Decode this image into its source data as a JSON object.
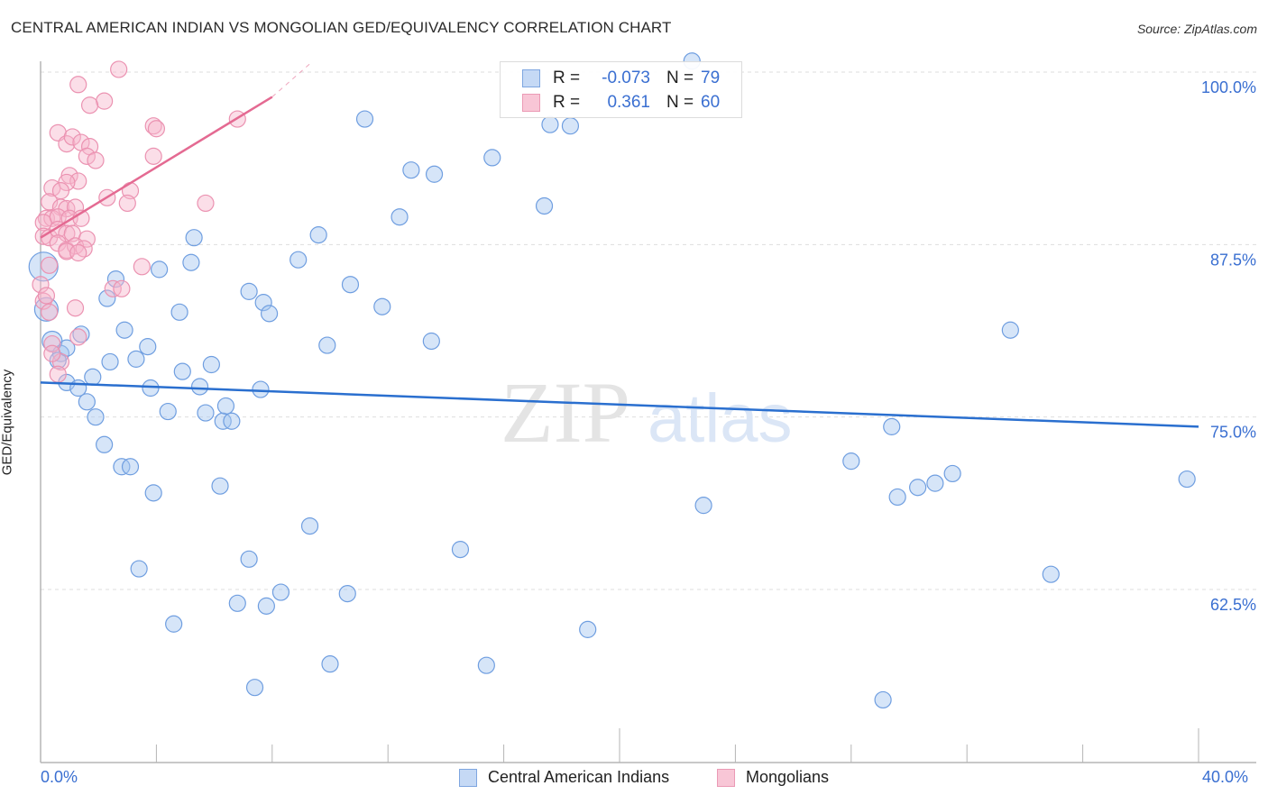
{
  "title": "CENTRAL AMERICAN INDIAN VS MONGOLIAN GED/EQUIVALENCY CORRELATION CHART",
  "source": "Source: ZipAtlas.com",
  "watermark": {
    "part1": "ZIP",
    "part2": "atlas"
  },
  "colors": {
    "blue": "#3a7bd5",
    "blue_fill": "#c5d9f5",
    "blue_line": "#2a6fcf",
    "pink": "#e8739a",
    "pink_fill": "#f8c6d6",
    "pink_line": "#e46a92",
    "axis_text": "#3a6fd1"
  },
  "legend": {
    "rows": [
      {
        "series": "Central American Indians",
        "r_label": "R =",
        "r_value": "-0.073",
        "n_label": "N =",
        "n_value": "79"
      },
      {
        "series": "Mongolians",
        "r_label": "R =",
        "r_value": "0.361",
        "n_label": "N =",
        "n_value": "60"
      }
    ]
  },
  "bottom_legend": [
    "Central American Indians",
    "Mongolians"
  ],
  "chart_data": {
    "type": "scatter",
    "title": "CENTRAL AMERICAN INDIAN VS MONGOLIAN GED/EQUIVALENCY CORRELATION CHART",
    "xlabel": "",
    "ylabel": "GED/Equivalency",
    "xlim": [
      0,
      40
    ],
    "ylim": [
      50,
      101.2
    ],
    "x_tick_labels": [
      "0.0%",
      "40.0%"
    ],
    "x_ticks": [
      0,
      4,
      8,
      12,
      16,
      20,
      24,
      28,
      32,
      36,
      40
    ],
    "y_ticks": [
      100.0,
      87.5,
      75.0,
      62.5
    ],
    "y_tick_labels": [
      "100.0%",
      "87.5%",
      "75.0%",
      "62.5%"
    ],
    "grid": "horizontal-dashed",
    "legend_position": "top-center",
    "series": [
      {
        "name": "Central American Indians",
        "r": -0.073,
        "n": 79,
        "trend": {
          "x": [
            0,
            40
          ],
          "y": [
            77.5,
            74.3
          ]
        },
        "points": [
          [
            0.1,
            85.9
          ],
          [
            0.2,
            82.8
          ],
          [
            0.4,
            80.5
          ],
          [
            0.7,
            79.6
          ],
          [
            0.6,
            79.1
          ],
          [
            0.9,
            80.0
          ],
          [
            1.4,
            81.0
          ],
          [
            0.9,
            77.5
          ],
          [
            1.3,
            77.1
          ],
          [
            1.8,
            77.9
          ],
          [
            1.6,
            76.1
          ],
          [
            1.9,
            75.0
          ],
          [
            2.2,
            73.0
          ],
          [
            2.4,
            79.0
          ],
          [
            2.6,
            85.0
          ],
          [
            2.3,
            83.6
          ],
          [
            2.9,
            81.3
          ],
          [
            3.3,
            79.2
          ],
          [
            3.7,
            80.1
          ],
          [
            3.8,
            77.1
          ],
          [
            2.8,
            71.4
          ],
          [
            3.1,
            71.4
          ],
          [
            3.9,
            69.5
          ],
          [
            3.4,
            64.0
          ],
          [
            4.1,
            85.7
          ],
          [
            4.4,
            75.4
          ],
          [
            4.8,
            82.6
          ],
          [
            4.9,
            78.3
          ],
          [
            5.2,
            86.2
          ],
          [
            5.3,
            88.0
          ],
          [
            5.5,
            77.2
          ],
          [
            5.7,
            75.3
          ],
          [
            5.9,
            78.8
          ],
          [
            6.2,
            70.0
          ],
          [
            6.3,
            74.7
          ],
          [
            6.4,
            75.8
          ],
          [
            6.6,
            74.7
          ],
          [
            7.2,
            84.1
          ],
          [
            7.7,
            83.3
          ],
          [
            7.9,
            82.5
          ],
          [
            7.6,
            77.0
          ],
          [
            4.6,
            60.0
          ],
          [
            6.8,
            61.5
          ],
          [
            7.2,
            64.7
          ],
          [
            7.4,
            55.4
          ],
          [
            7.8,
            61.3
          ],
          [
            8.3,
            62.3
          ],
          [
            8.9,
            86.4
          ],
          [
            9.3,
            67.1
          ],
          [
            9.6,
            88.2
          ],
          [
            9.9,
            80.2
          ],
          [
            10.0,
            57.1
          ],
          [
            10.6,
            62.2
          ],
          [
            10.7,
            84.6
          ],
          [
            11.8,
            83.0
          ],
          [
            11.2,
            96.6
          ],
          [
            12.4,
            89.5
          ],
          [
            12.8,
            92.9
          ],
          [
            13.6,
            92.6
          ],
          [
            13.5,
            80.5
          ],
          [
            14.5,
            65.4
          ],
          [
            15.4,
            57.0
          ],
          [
            15.6,
            93.8
          ],
          [
            17.4,
            90.3
          ],
          [
            17.6,
            96.2
          ],
          [
            18.3,
            96.1
          ],
          [
            18.9,
            59.6
          ],
          [
            22.9,
            68.6
          ],
          [
            28.0,
            71.8
          ],
          [
            29.4,
            74.3
          ],
          [
            29.1,
            54.5
          ],
          [
            29.6,
            69.2
          ],
          [
            30.3,
            69.9
          ],
          [
            30.9,
            70.2
          ],
          [
            31.5,
            70.9
          ],
          [
            33.5,
            81.3
          ],
          [
            34.9,
            63.6
          ],
          [
            39.6,
            70.5
          ],
          [
            22.5,
            100.8
          ]
        ]
      },
      {
        "name": "Mongolians",
        "r": 0.361,
        "n": 60,
        "trend": {
          "x": [
            0,
            8.0
          ],
          "y": [
            88.0,
            98.2
          ]
        },
        "trend_dashed_extension": {
          "x": [
            8.0,
            9.3
          ],
          "y": [
            98.2,
            100.6
          ]
        },
        "points": [
          [
            2.7,
            100.2
          ],
          [
            1.3,
            99.1
          ],
          [
            2.2,
            97.9
          ],
          [
            1.7,
            97.6
          ],
          [
            3.9,
            96.1
          ],
          [
            4.0,
            95.9
          ],
          [
            6.8,
            96.6
          ],
          [
            0.6,
            95.6
          ],
          [
            0.9,
            94.8
          ],
          [
            1.1,
            95.3
          ],
          [
            1.4,
            94.9
          ],
          [
            1.7,
            94.6
          ],
          [
            1.6,
            93.9
          ],
          [
            1.9,
            93.6
          ],
          [
            3.9,
            93.9
          ],
          [
            1.0,
            92.5
          ],
          [
            1.3,
            92.1
          ],
          [
            0.9,
            92.0
          ],
          [
            0.4,
            91.6
          ],
          [
            0.7,
            91.4
          ],
          [
            2.3,
            90.9
          ],
          [
            3.1,
            91.4
          ],
          [
            3.0,
            90.5
          ],
          [
            5.7,
            90.5
          ],
          [
            0.3,
            90.6
          ],
          [
            0.7,
            90.2
          ],
          [
            0.9,
            90.1
          ],
          [
            1.2,
            90.2
          ],
          [
            0.2,
            89.4
          ],
          [
            0.4,
            89.4
          ],
          [
            0.1,
            89.1
          ],
          [
            0.6,
            89.5
          ],
          [
            1.0,
            89.4
          ],
          [
            1.4,
            89.4
          ],
          [
            0.1,
            88.1
          ],
          [
            0.3,
            88.0
          ],
          [
            0.6,
            88.6
          ],
          [
            0.9,
            88.3
          ],
          [
            1.1,
            88.3
          ],
          [
            1.6,
            87.9
          ],
          [
            0.6,
            87.6
          ],
          [
            0.9,
            87.1
          ],
          [
            1.2,
            87.4
          ],
          [
            1.5,
            87.2
          ],
          [
            0.9,
            87.0
          ],
          [
            1.3,
            86.9
          ],
          [
            3.5,
            85.9
          ],
          [
            0.3,
            86.0
          ],
          [
            0.0,
            84.6
          ],
          [
            0.1,
            83.4
          ],
          [
            1.2,
            82.9
          ],
          [
            2.5,
            84.3
          ],
          [
            2.8,
            84.3
          ],
          [
            0.3,
            82.6
          ],
          [
            1.3,
            80.8
          ],
          [
            0.4,
            80.3
          ],
          [
            0.7,
            79.0
          ],
          [
            0.6,
            78.1
          ],
          [
            0.4,
            79.6
          ],
          [
            0.2,
            83.8
          ]
        ]
      }
    ]
  }
}
